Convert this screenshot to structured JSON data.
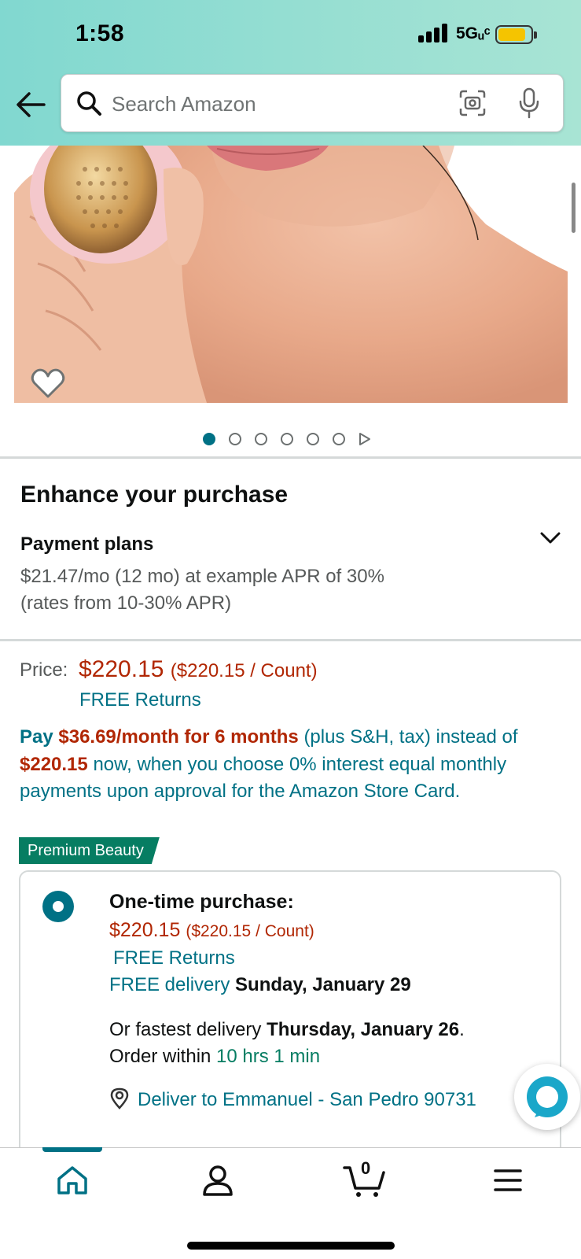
{
  "status_bar": {
    "time": "1:58",
    "network": "5Gᵤᶜ"
  },
  "search": {
    "placeholder": "Search Amazon"
  },
  "product": {
    "image_dots_count": 6,
    "active_dot": 0
  },
  "enhance": {
    "title": "Enhance your purchase",
    "payment_plans_title": "Payment plans",
    "payment_line_1": "$21.47/mo (12 mo) at example APR of 30%",
    "payment_line_2": "(rates from 10-30% APR)"
  },
  "price": {
    "label": "Price:",
    "amount": "$220.15",
    "per_unit": "($220.15 / Count)",
    "returns": "FREE Returns"
  },
  "promo": {
    "pay_word": "Pay",
    "monthly": "$36.69/month for 6 months",
    "text_1": "(plus S&H, tax) instead of",
    "full_price": "$220.15",
    "text_2": "now, when you choose 0% interest equal monthly payments upon approval for the Amazon Store Card."
  },
  "badge": {
    "label": "Premium Beauty"
  },
  "one_time": {
    "title": "One-time purchase:",
    "price": "$220.15",
    "per_unit": "($220.15 / Count)",
    "returns": "FREE Returns",
    "delivery_label": "FREE delivery",
    "delivery_date": "Sunday, January 29",
    "fastest_prefix": "Or fastest delivery",
    "fastest_date": "Thursday, January 26",
    "fastest_period": ".",
    "order_within": "Order within",
    "countdown": "10 hrs 1 min",
    "deliver_to": "Deliver to Emmanuel - San Pedro 90731"
  },
  "bottom_nav": {
    "cart_count": "0"
  },
  "colors": {
    "accent": "#007185",
    "price": "#B12704",
    "badge": "#067d62",
    "header": "#a8e4d4"
  }
}
